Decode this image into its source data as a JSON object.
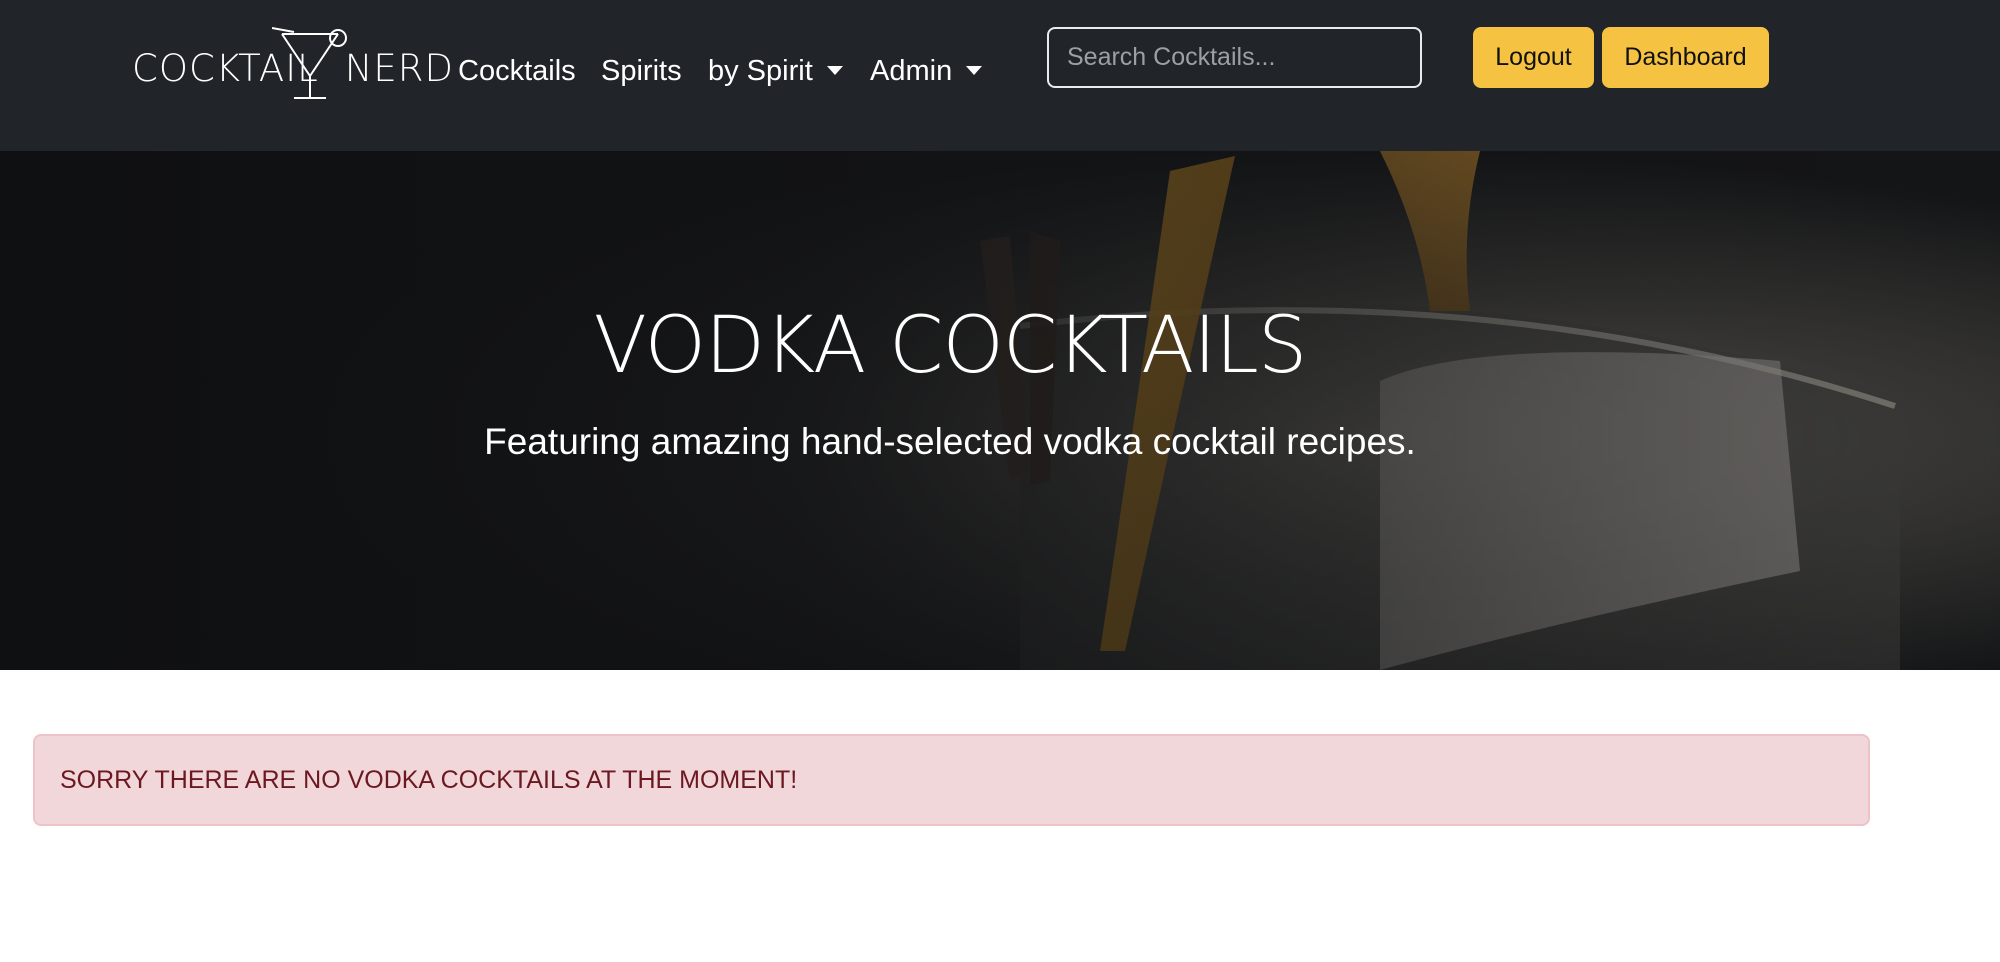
{
  "brand": {
    "name": "COCKTAIL NERD"
  },
  "nav": {
    "items": [
      {
        "label": "Cocktails"
      },
      {
        "label": "Spirits"
      },
      {
        "label": "by Spirit"
      },
      {
        "label": "Admin"
      }
    ]
  },
  "search": {
    "placeholder": "Search Cocktails...",
    "value": ""
  },
  "buttons": {
    "logout": "Logout",
    "dashboard": "Dashboard"
  },
  "hero": {
    "title": "VODKA COCKTAILS",
    "subtitle": "Featuring amazing hand-selected vodka cocktail recipes."
  },
  "alert": {
    "message": "SORRY THERE ARE NO VODKA COCKTAILS AT THE MOMENT!"
  },
  "colors": {
    "navbar": "#212529",
    "accent": "#f5c242",
    "alert_bg": "#f1d7da",
    "alert_text": "#6b1820"
  },
  "icons": {
    "brand_logo": "martini-glass-icon",
    "dropdown": "caret-down-icon"
  }
}
